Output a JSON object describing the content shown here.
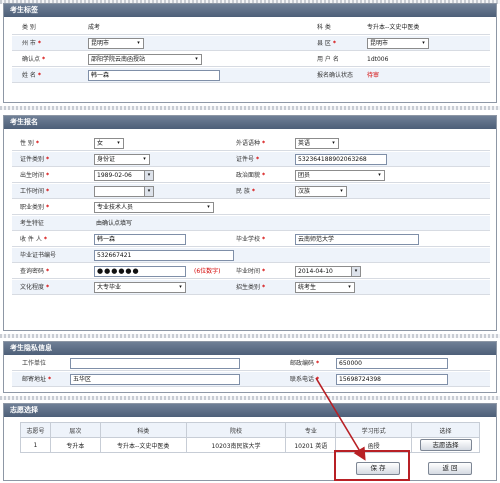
{
  "sections": {
    "exam_tag": "考生标签",
    "registration": "考生报名",
    "privacy": "考生隐私信息",
    "preference": "志愿选择"
  },
  "tag": {
    "category_label": "类    别",
    "category_value": "成考",
    "subject_label": "科    类",
    "subject_value": "专升本--文史中医类",
    "city_label": "州  市",
    "city_value": "昆明市",
    "district_label": "县    区",
    "district_value": "昆明市",
    "confirm_point_label": "确认点",
    "confirm_point_value": "邵阳学院云南函授站",
    "username_label": "用 户 名",
    "username_value": "1dt006",
    "name_label": "姓    名",
    "name_value": "韩一森",
    "status_label": "报名确认状态",
    "status_value": "待审"
  },
  "reg": {
    "gender_label": "性    别",
    "gender_value": "女",
    "foreign_lang_label": "外语语种",
    "foreign_lang_value": "英语",
    "id_type_label": "证件类别",
    "id_type_value": "身份证",
    "id_no_label": "证件号",
    "id_no_value": "532364188902063268",
    "birth_label": "出生时间",
    "birth_value": "1989-02-06",
    "politics_label": "政治面貌",
    "politics_value": "团员",
    "work_time_label": "工作时间",
    "work_time_value": "",
    "nation_label": "民    族",
    "nation_value": "汉族",
    "occupation_label": "职业类别",
    "occupation_value": "专业技术人员",
    "region_label": "考生特征",
    "region_value": "由确认点填写",
    "recipient_label": "收 件 人",
    "recipient_value": "韩一森",
    "school_label": "毕业学校",
    "school_value": "云南师范大学",
    "cert_no_label": "毕业证书编号",
    "cert_no_value": "532667421",
    "password_label": "查询密码",
    "password_value": "●●●●●●",
    "password_hint": "(6位数字)",
    "grad_time_label": "毕业时间",
    "grad_time_value": "2014-04-10",
    "education_label": "文化程度",
    "education_value": "大专毕业",
    "enroll_label": "招生类别",
    "enroll_value": "统考生"
  },
  "privacy": {
    "work_unit_label": "工作单位",
    "work_unit_value": "",
    "postcode_label": "邮政编码",
    "postcode_value": "650000",
    "address_label": "邮寄地址",
    "address_value": "五华区",
    "phone_label": "联系电话",
    "phone_value": "15698724398"
  },
  "pref": {
    "headers": [
      "志愿号",
      "层次",
      "科类",
      "院校",
      "专业",
      "学习形式",
      "选择"
    ],
    "row": [
      "1",
      "专升本",
      "专升本--文史中医类",
      "10203南民族大学",
      "10201 英语",
      "函授",
      "志愿选择"
    ]
  },
  "buttons": {
    "save": "保  存",
    "back": "返  回"
  },
  "icons": {
    "dropdown": "chevron-down-icon",
    "calendar": "calendar-icon"
  },
  "colors": {
    "header_bar": "#5a6b84",
    "required": "#d40000",
    "highlight_box": "#b82025",
    "row_alt": "#eef3fa"
  }
}
